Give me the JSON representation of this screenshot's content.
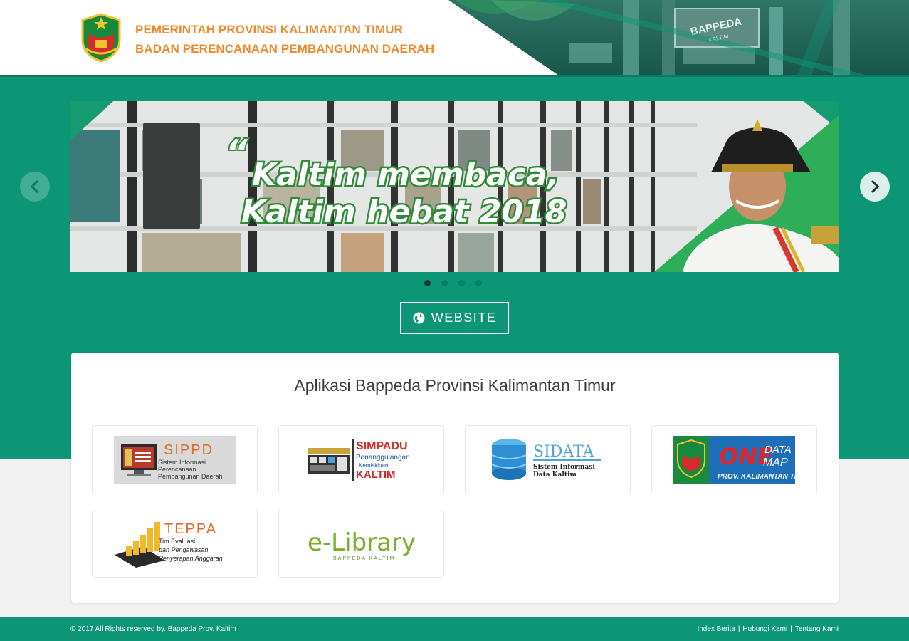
{
  "header": {
    "title_line1": "PEMERINTAH PROVINSI KALIMANTAN TIMUR",
    "title_line2": "BADAN PERENCANAAN PEMBANGUNAN DAERAH",
    "building_sign_main": "BAPPEDA",
    "building_sign_sub": "KALTIM"
  },
  "slider": {
    "quote_mark": "“",
    "line1": "Kaltim membaca,",
    "line2": "Kaltim hebat 2018",
    "active_slide": 1,
    "slide_count": 4
  },
  "website_button": {
    "label": "WEBSITE",
    "icon": "globe-icon"
  },
  "apps": {
    "title": "Aplikasi Bappeda Provinsi Kalimantan Timur",
    "sippd": {
      "name": "SIPPD",
      "line1": "Sistem Informasi",
      "line2": "Perencanaan",
      "line3": "Pembangunan Daerah"
    },
    "simpadu": {
      "name": "SIMPADU",
      "line1": "Penanggulangan",
      "line2": "Kemiskinan",
      "line3": "KALTIM"
    },
    "sidata": {
      "name": "SIDATA",
      "line1": "Sistem Informasi",
      "line2": "Data Kaltim"
    },
    "onedatamap": {
      "word1": "ONE",
      "word2": "DATA",
      "word3": "MAP",
      "sub": "PROV. KALIMANTAN TIMUR"
    },
    "teppa": {
      "name": "TEPPA",
      "line1": "Tim Evaluasi",
      "line2": "dan Pengawasan",
      "line3": "Penyerapan Anggaran"
    },
    "elibrary": {
      "name": "e-Library",
      "sub": "BAPPEDA KALTIM"
    }
  },
  "footer": {
    "copyright": "© 2017 All Rights reserved by. Bappeda Prov. Kaltim",
    "link_index": "Index Berita",
    "link_contact": "Hubungi Kami",
    "link_about": "Tentang Kami",
    "separator": "|"
  },
  "colors": {
    "brand_green": "#0d9676",
    "title_orange": "#ee8a2c",
    "footer_green": "#0d9676"
  }
}
